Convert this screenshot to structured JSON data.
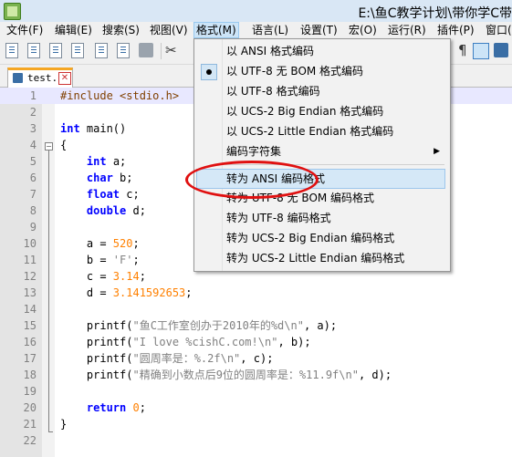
{
  "window": {
    "title": "E:\\鱼C教学计划\\带你学C带"
  },
  "menubar": {
    "items": [
      {
        "label": "文件(F)",
        "name": "menu-file"
      },
      {
        "label": "编辑(E)",
        "name": "menu-edit"
      },
      {
        "label": "搜索(S)",
        "name": "menu-search"
      },
      {
        "label": "视图(V)",
        "name": "menu-view"
      },
      {
        "label": "格式(M)",
        "name": "menu-format"
      },
      {
        "label": "语言(L)",
        "name": "menu-language"
      },
      {
        "label": "设置(T)",
        "name": "menu-settings"
      },
      {
        "label": "宏(O)",
        "name": "menu-macro"
      },
      {
        "label": "运行(R)",
        "name": "menu-run"
      },
      {
        "label": "插件(P)",
        "name": "menu-plugins"
      },
      {
        "label": "窗口(",
        "name": "menu-window"
      }
    ]
  },
  "toolbar": {
    "icons": [
      "new-file-icon",
      "open-file-icon",
      "save-icon",
      "save-all-icon",
      "close-icon",
      "close-all-icon",
      "print-icon",
      "cut-icon",
      "paragraph-icon",
      "word-wrap-icon",
      "document-map-icon"
    ],
    "glyphs": {
      "cut": "✂",
      "paragraph": "¶"
    }
  },
  "tab": {
    "label": "test.",
    "close": "✕"
  },
  "format_menu": {
    "items": [
      {
        "label": "以 ANSI 格式编码",
        "checked": false
      },
      {
        "label": "以 UTF-8 无 BOM 格式编码",
        "checked": true
      },
      {
        "label": "以 UTF-8 格式编码",
        "checked": false
      },
      {
        "label": "以 UCS-2 Big Endian 格式编码",
        "checked": false
      },
      {
        "label": "以 UCS-2 Little Endian 格式编码",
        "checked": false
      },
      {
        "label": "编码字符集",
        "checked": false,
        "submenu": true
      },
      {
        "label": "转为 ANSI 编码格式",
        "checked": false,
        "highlight": true
      },
      {
        "label": "转为 UTF-8 无 BOM 编码格式",
        "checked": false
      },
      {
        "label": "转为 UTF-8 编码格式",
        "checked": false
      },
      {
        "label": "转为 UCS-2 Big Endian 编码格式",
        "checked": false
      },
      {
        "label": "转为 UCS-2 Little Endian 编码格式",
        "checked": false
      }
    ],
    "submenu_arrow": "▶"
  },
  "editor": {
    "current_line": 1,
    "lines": [
      {
        "n": "1",
        "code": "#include <stdio.h>"
      },
      {
        "n": "2",
        "code": ""
      },
      {
        "n": "3",
        "code": "int main()"
      },
      {
        "n": "4",
        "code": "{"
      },
      {
        "n": "5",
        "code": "    int a;"
      },
      {
        "n": "6",
        "code": "    char b;"
      },
      {
        "n": "7",
        "code": "    float c;"
      },
      {
        "n": "8",
        "code": "    double d;"
      },
      {
        "n": "9",
        "code": ""
      },
      {
        "n": "10",
        "code": "    a = 520;"
      },
      {
        "n": "11",
        "code": "    b = 'F';"
      },
      {
        "n": "12",
        "code": "    c = 3.14;"
      },
      {
        "n": "13",
        "code": "    d = 3.141592653;"
      },
      {
        "n": "14",
        "code": ""
      },
      {
        "n": "15",
        "code": "    printf(\"鱼C工作室创办于2010年的%d\\n\", a);"
      },
      {
        "n": "16",
        "code": "    printf(\"I love %cishC.com!\\n\", b);"
      },
      {
        "n": "17",
        "code": "    printf(\"圆周率是：%.2f\\n\", c);"
      },
      {
        "n": "18",
        "code": "    printf(\"精确到小数点后9位的圆周率是：%11.9f\\n\", d);"
      },
      {
        "n": "19",
        "code": ""
      },
      {
        "n": "20",
        "code": "    return 0;"
      },
      {
        "n": "21",
        "code": "}"
      },
      {
        "n": "22",
        "code": ""
      }
    ]
  },
  "colors": {
    "keyword": "#0000ff",
    "preprocessor": "#804000",
    "number": "#ff8000",
    "string": "#808080",
    "annotation_circle": "#e01010"
  }
}
